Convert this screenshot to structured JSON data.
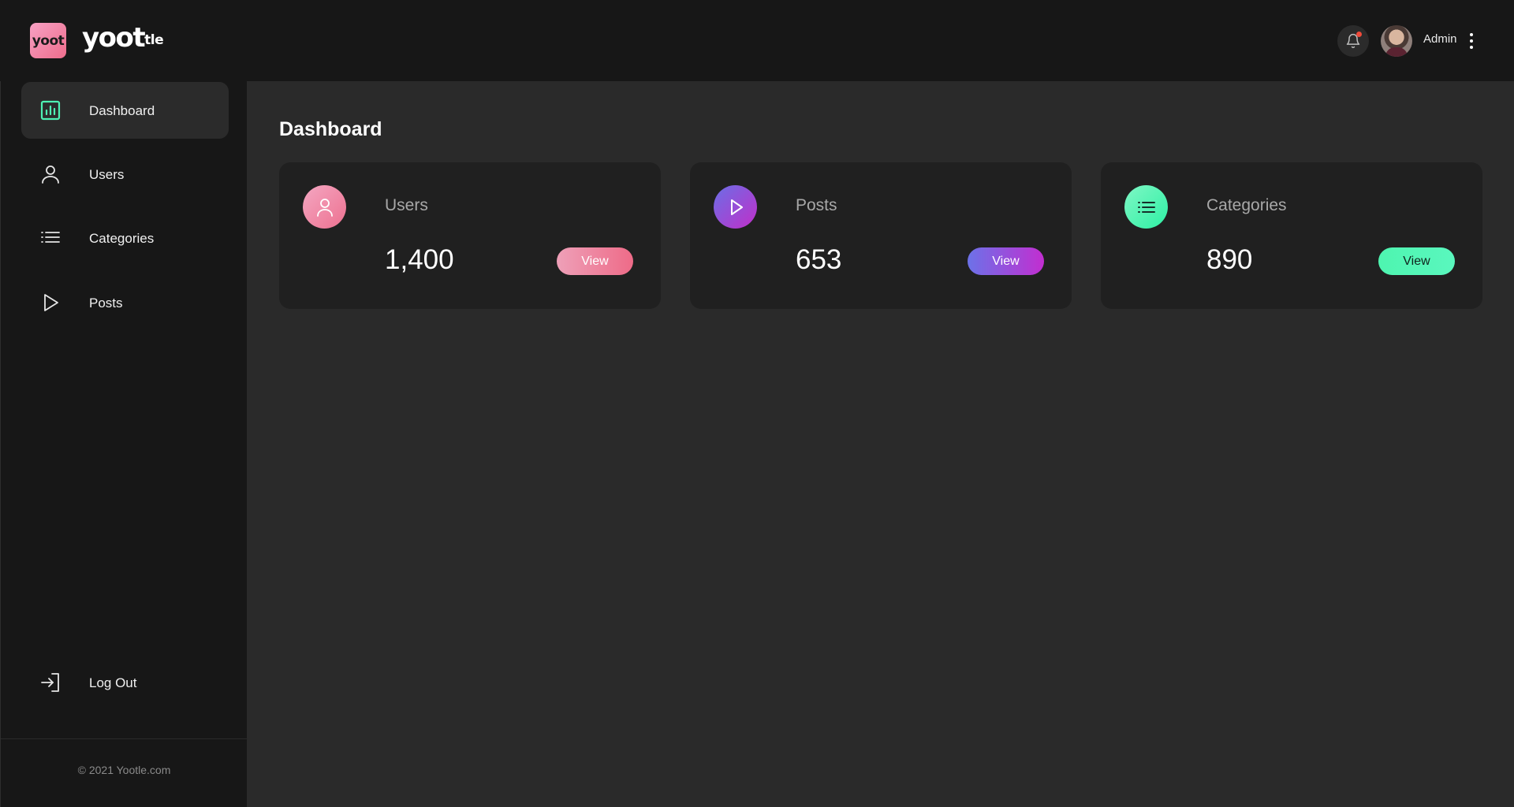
{
  "brand": {
    "logo_badge_text": "yoot",
    "wordmark_main": "yoot",
    "wordmark_suffix": "tle"
  },
  "header": {
    "user_name": "Admin",
    "notification_dot": true
  },
  "sidebar": {
    "items": [
      {
        "label": "Dashboard",
        "icon": "bar-chart-icon",
        "active": true
      },
      {
        "label": "Users",
        "icon": "user-icon",
        "active": false
      },
      {
        "label": "Categories",
        "icon": "list-icon",
        "active": false
      },
      {
        "label": "Posts",
        "icon": "play-icon",
        "active": false
      }
    ],
    "logout_label": "Log Out",
    "copyright": "© 2021 Yootle.com"
  },
  "main": {
    "title": "Dashboard",
    "cards": [
      {
        "title": "Users",
        "value": "1,400",
        "button": "View",
        "icon": "user-icon",
        "accent": "#ee7896"
      },
      {
        "title": "Posts",
        "value": "653",
        "button": "View",
        "icon": "play-icon",
        "accent": "#9b3fd8"
      },
      {
        "title": "Categories",
        "value": "890",
        "button": "View",
        "icon": "list-icon",
        "accent": "#4ef5b0"
      }
    ]
  },
  "colors": {
    "background": "#2a2a2a",
    "sidebar": "#171717",
    "card": "#202020",
    "active_item": "#2b2b2b",
    "dashboard_icon": "#4ef0b3",
    "notification": "#f04a3a"
  }
}
